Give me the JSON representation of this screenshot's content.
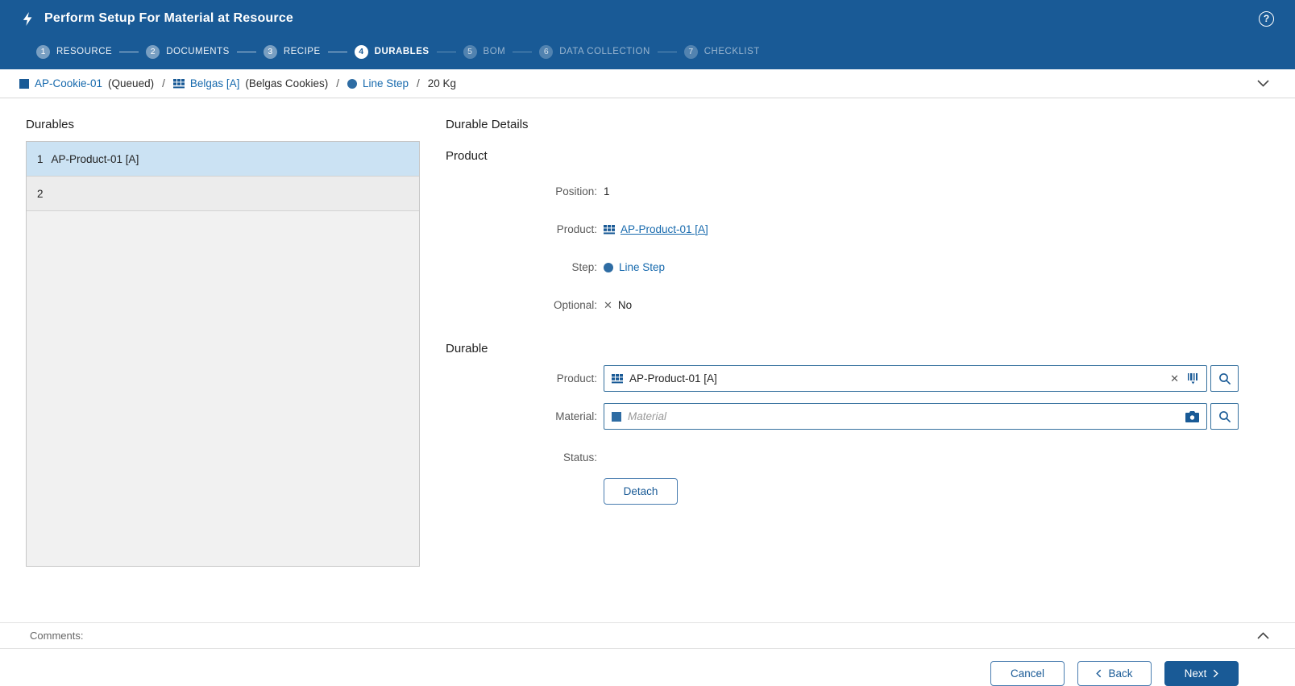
{
  "colors": {
    "header_bg": "#195a96",
    "accent": "#195a96",
    "link": "#1669ad",
    "selected_row_bg": "#cbe2f3"
  },
  "icons": {
    "clear_x": "✕",
    "x_mark": "✕"
  },
  "header": {
    "title": "Perform Setup For Material at Resource",
    "help_label": "?"
  },
  "stepper": {
    "steps": [
      {
        "number": "1",
        "label": "RESOURCE",
        "state": "done"
      },
      {
        "number": "2",
        "label": "DOCUMENTS",
        "state": "done"
      },
      {
        "number": "3",
        "label": "RECIPE",
        "state": "done"
      },
      {
        "number": "4",
        "label": "DURABLES",
        "state": "active"
      },
      {
        "number": "5",
        "label": "BOM",
        "state": "todo"
      },
      {
        "number": "6",
        "label": "DATA COLLECTION",
        "state": "todo"
      },
      {
        "number": "7",
        "label": "CHECKLIST",
        "state": "todo"
      }
    ]
  },
  "breadcrumb": {
    "separator": "/",
    "sfc": {
      "text": "AP-Cookie-01",
      "suffix": "(Queued)"
    },
    "material": {
      "text": "Belgas [A]",
      "suffix": "(Belgas Cookies)"
    },
    "step": {
      "text": "Line Step"
    },
    "quantity": {
      "text": "20 Kg"
    }
  },
  "durables_panel": {
    "title": "Durables",
    "rows": [
      {
        "position": "1",
        "name": "AP-Product-01 [A]",
        "selected": true
      },
      {
        "position": "2",
        "name": "",
        "selected": false
      }
    ]
  },
  "details": {
    "title": "Durable Details",
    "product_section": {
      "title": "Product",
      "position": {
        "label": "Position:",
        "value": "1"
      },
      "product": {
        "label": "Product:",
        "value": "AP-Product-01 [A]"
      },
      "step": {
        "label": "Step:",
        "value": "Line Step"
      },
      "optional": {
        "label": "Optional:",
        "value": "No"
      }
    },
    "durable_section": {
      "title": "Durable",
      "product": {
        "label": "Product:",
        "value": "AP-Product-01 [A]"
      },
      "material": {
        "label": "Material:",
        "placeholder": "Material"
      },
      "status": {
        "label": "Status:",
        "value": ""
      },
      "detach_button": "Detach"
    }
  },
  "comments": {
    "label": "Comments:"
  },
  "footer": {
    "cancel_label": "Cancel",
    "back_label": "Back",
    "next_label": "Next"
  }
}
